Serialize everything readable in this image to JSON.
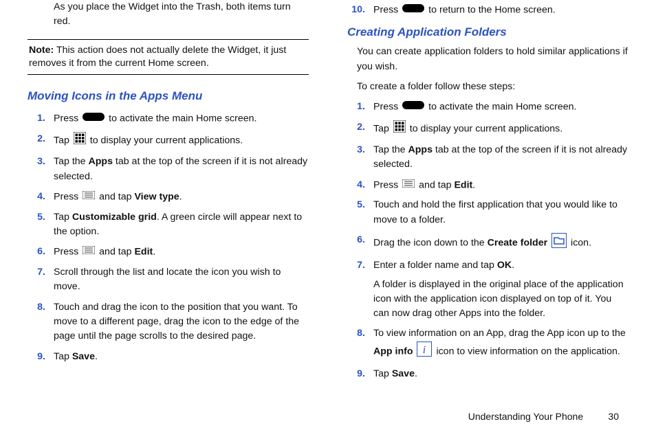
{
  "left": {
    "intro": "As you place the Widget into the Trash, both items turn red.",
    "note_label": "Note:",
    "note": " This action does not actually delete the Widget, it just removes it from the current Home screen.",
    "heading": "Moving Icons in the Apps Menu",
    "s1_a": "Press ",
    "s1_b": " to activate the main Home screen.",
    "s2_a": "Tap ",
    "s2_b": " to display your current applications.",
    "s3_a": "Tap the ",
    "s3_apps": "Apps",
    "s3_b": " tab at the top of the screen if it is not already selected.",
    "s4_a": "Press ",
    "s4_b": " and tap ",
    "s4_view": "View type",
    "s4_c": ".",
    "s5_a": "Tap ",
    "s5_cg": "Customizable grid",
    "s5_b": ". A green circle will appear next to the option.",
    "s6_a": "Press ",
    "s6_b": " and tap ",
    "s6_edit": "Edit",
    "s6_c": ".",
    "s7": "Scroll through the list and locate the icon you wish to move.",
    "s8": "Touch and drag the icon to the position that you want. To move to a different page, drag the icon to the edge of the page until the page scrolls to the desired page.",
    "s9_a": "Tap ",
    "s9_save": "Save",
    "s9_b": "."
  },
  "right": {
    "s10_a": "Press ",
    "s10_b": " to return to the Home screen.",
    "heading": "Creating Application Folders",
    "intro1": "You can create application folders to hold similar applications if you wish.",
    "intro2": "To create a folder follow these steps:",
    "s1_a": "Press ",
    "s1_b": " to activate the main Home screen.",
    "s2_a": "Tap ",
    "s2_b": " to display your current applications.",
    "s3_a": "Tap the ",
    "s3_apps": "Apps",
    "s3_b": " tab at the top of the screen if it is not already selected.",
    "s4_a": "Press ",
    "s4_b": " and tap ",
    "s4_edit": "Edit",
    "s4_c": ".",
    "s5": "Touch and hold the first application that you would like to move to a folder.",
    "s6_a": "Drag the icon down to the ",
    "s6_cf": "Create folder",
    "s6_b": " icon.",
    "s7_a": "Enter a folder name and tap ",
    "s7_ok": "OK",
    "s7_b": ".",
    "s7_sub": "A folder is displayed in the original place of the application icon with the application icon displayed on top of it. You can now drag other Apps into the folder.",
    "s8_a": "To view information on an App, drag the App icon up to the ",
    "s8_ai": "App info",
    "s8_b": " icon to view information on the application.",
    "s9_a": "Tap ",
    "s9_save": "Save",
    "s9_b": "."
  },
  "footer": {
    "title": "Understanding Your Phone",
    "num": "30"
  }
}
